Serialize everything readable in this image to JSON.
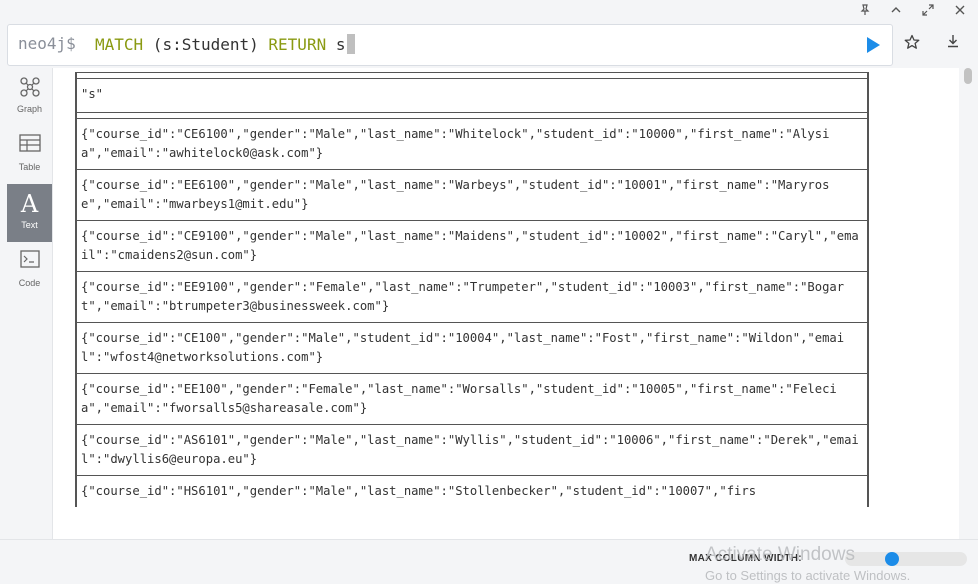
{
  "window_controls": {
    "pin_icon": "pin-icon",
    "collapse_icon": "chevron-up-icon",
    "expand_icon": "expand-icon",
    "close_icon": "close-icon"
  },
  "editor": {
    "prompt": "neo4j$",
    "query_kw1": "MATCH",
    "query_mid": " (s:Student) ",
    "query_kw2": "RETURN",
    "query_tail": " s"
  },
  "sidebar": {
    "items": [
      {
        "label": "Graph",
        "icon": "graph-icon"
      },
      {
        "label": "Table",
        "icon": "table-icon"
      },
      {
        "label": "Text",
        "icon": "text-icon"
      },
      {
        "label": "Code",
        "icon": "code-icon"
      }
    ],
    "active": "Text"
  },
  "result": {
    "header": "\"s\"",
    "rows": [
      "{\"course_id\":\"CE6100\",\"gender\":\"Male\",\"last_name\":\"Whitelock\",\"student_id\":\"10000\",\"first_name\":\"Alysia\",\"email\":\"awhitelock0@ask.com\"}",
      "{\"course_id\":\"EE6100\",\"gender\":\"Male\",\"last_name\":\"Warbeys\",\"student_id\":\"10001\",\"first_name\":\"Maryrose\",\"email\":\"mwarbeys1@mit.edu\"}",
      "{\"course_id\":\"CE9100\",\"gender\":\"Male\",\"last_name\":\"Maidens\",\"student_id\":\"10002\",\"first_name\":\"Caryl\",\"email\":\"cmaidens2@sun.com\"}",
      "{\"course_id\":\"EE9100\",\"gender\":\"Female\",\"last_name\":\"Trumpeter\",\"student_id\":\"10003\",\"first_name\":\"Bogart\",\"email\":\"btrumpeter3@businessweek.com\"}",
      "{\"course_id\":\"CE100\",\"gender\":\"Male\",\"student_id\":\"10004\",\"last_name\":\"Fost\",\"first_name\":\"Wildon\",\"email\":\"wfost4@networksolutions.com\"}",
      "{\"course_id\":\"EE100\",\"gender\":\"Female\",\"last_name\":\"Worsalls\",\"student_id\":\"10005\",\"first_name\":\"Felecia\",\"email\":\"fworsalls5@shareasale.com\"}",
      "{\"course_id\":\"AS6101\",\"gender\":\"Male\",\"last_name\":\"Wyllis\",\"student_id\":\"10006\",\"first_name\":\"Derek\",\"email\":\"dwyllis6@europa.eu\"}",
      "{\"course_id\":\"HS6101\",\"gender\":\"Male\",\"last_name\":\"Stollenbecker\",\"student_id\":\"10007\",\"firs"
    ]
  },
  "footer": {
    "max_column_width_label": "MAX COLUMN WIDTH:",
    "slider_value_fraction": 0.33
  },
  "watermark": {
    "line1": "Activate Windows",
    "line2": "Go to Settings to activate Windows."
  },
  "colors": {
    "accent": "#1c8ce8",
    "keyword": "#8a9a12"
  }
}
